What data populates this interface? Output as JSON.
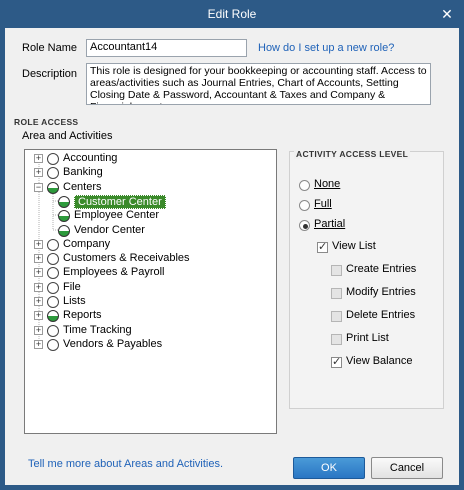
{
  "window": {
    "title": "Edit Role",
    "close_glyph": "✕"
  },
  "form": {
    "role_name_label": "Role Name",
    "role_name_value": "Accountant14",
    "role_help_link": "How do I set up a new role?",
    "description_label": "Description",
    "description_value": "This role is designed for your bookkeeping or accounting staff. Access to areas/activities such as Journal Entries, Chart of Accounts, Setting Closing Date & Password, Accountant & Taxes and Company & Financial reports."
  },
  "role_access": {
    "section_title": "ROLE ACCESS",
    "tree_label": "Area and Activities",
    "items": [
      {
        "label": "Accounting",
        "expander": "+",
        "state": "none"
      },
      {
        "label": "Banking",
        "expander": "+",
        "state": "none"
      },
      {
        "label": "Centers",
        "expander": "−",
        "state": "half"
      },
      {
        "label": "Customer Center",
        "expander": "",
        "state": "half",
        "selected": true
      },
      {
        "label": "Employee Center",
        "expander": "",
        "state": "half"
      },
      {
        "label": "Vendor Center",
        "expander": "",
        "state": "half"
      },
      {
        "label": "Company",
        "expander": "+",
        "state": "none"
      },
      {
        "label": "Customers & Receivables",
        "expander": "+",
        "state": "none"
      },
      {
        "label": "Employees & Payroll",
        "expander": "+",
        "state": "none"
      },
      {
        "label": "File",
        "expander": "+",
        "state": "none"
      },
      {
        "label": "Lists",
        "expander": "+",
        "state": "none"
      },
      {
        "label": "Reports",
        "expander": "+",
        "state": "half"
      },
      {
        "label": "Time Tracking",
        "expander": "+",
        "state": "none"
      },
      {
        "label": "Vendors & Payables",
        "expander": "+",
        "state": "none"
      }
    ]
  },
  "access_level": {
    "title": "ACTIVITY ACCESS LEVEL",
    "none_label": "None",
    "full_label": "Full",
    "partial_label": "Partial",
    "selected": "Partial",
    "options": [
      {
        "label": "View List",
        "checked": true,
        "enabled": true
      },
      {
        "label": "Create Entries",
        "checked": false,
        "enabled": false
      },
      {
        "label": "Modify Entries",
        "checked": false,
        "enabled": false
      },
      {
        "label": "Delete Entries",
        "checked": false,
        "enabled": false
      },
      {
        "label": "Print List",
        "checked": false,
        "enabled": false
      },
      {
        "label": "View Balance",
        "checked": true,
        "enabled": true
      }
    ]
  },
  "footer": {
    "help_link": "Tell me more about Areas and Activities.",
    "ok_label": "OK",
    "cancel_label": "Cancel"
  },
  "colors": {
    "titlebar": "#2d5a87",
    "selection": "#3a8a2a",
    "partial_green": "#2d9a3c",
    "link": "#1f62b8"
  }
}
